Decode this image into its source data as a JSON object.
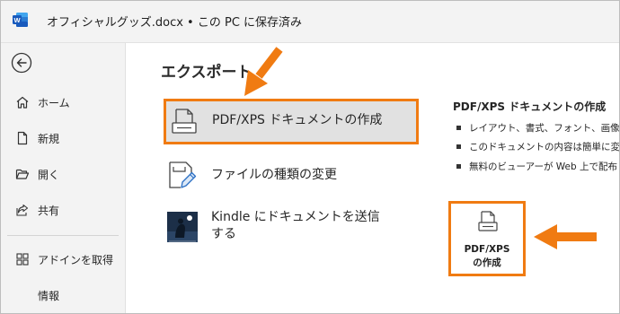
{
  "titlebar": {
    "document_title": "オフィシャルグッズ.docx • この PC に保存済み",
    "app_icon": "word-icon"
  },
  "sidebar": {
    "back_icon": "back-arrow-icon",
    "items": [
      {
        "label": "ホーム",
        "icon": "home-icon"
      },
      {
        "label": "新規",
        "icon": "new-document-icon"
      },
      {
        "label": "開く",
        "icon": "folder-open-icon"
      },
      {
        "label": "共有",
        "icon": "share-icon"
      },
      {
        "label": "アドインを取得",
        "icon": "addin-grid-icon"
      },
      {
        "label": "情報",
        "icon": ""
      }
    ]
  },
  "main": {
    "title": "エクスポート",
    "options": [
      {
        "label": "PDF/XPS ドキュメントの作成",
        "icon": "pdf-document-icon",
        "selected": true
      },
      {
        "label": "ファイルの種類の変更",
        "icon": "change-file-type-icon",
        "selected": false
      },
      {
        "label": "Kindle にドキュメントを送信する",
        "icon": "kindle-reader-icon",
        "selected": false
      }
    ],
    "detail": {
      "title": "PDF/XPS ドキュメントの作成",
      "bullets": [
        "レイアウト、書式、フォント、画像が",
        "このドキュメントの内容は簡単に変",
        "無料のビューアーが Web 上で配布"
      ]
    },
    "create_button": {
      "line1": "PDF/XPS",
      "line2": "の作成",
      "icon": "pdf-document-icon"
    }
  },
  "colors": {
    "highlight": "#f07b12",
    "sidebar_bg": "#f3f3f3",
    "selected_bg": "#e1e1e1",
    "word_blue": "#185abd"
  }
}
